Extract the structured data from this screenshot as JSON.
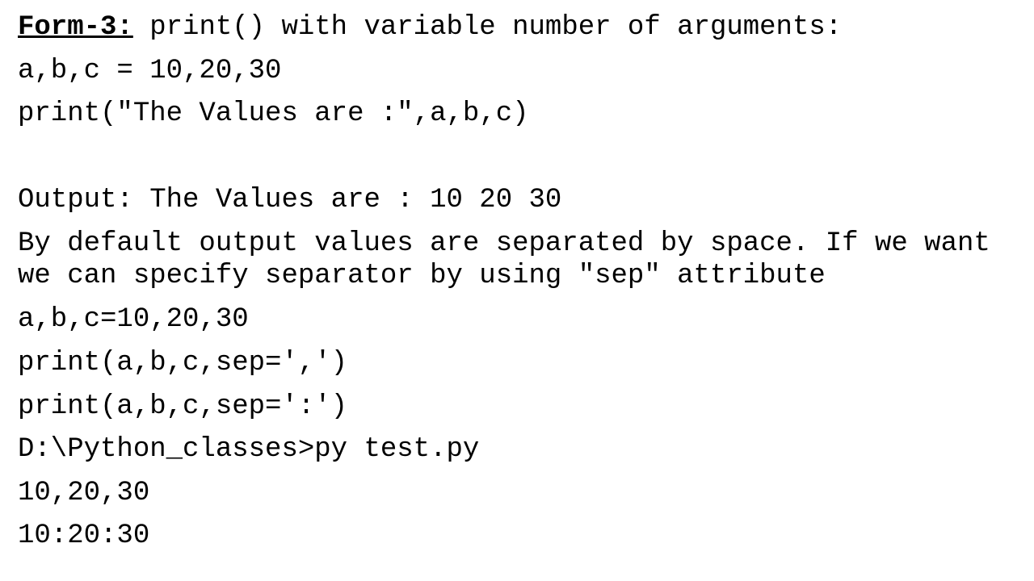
{
  "heading": {
    "label": "Form-3:",
    "text": " print() with variable number of arguments:"
  },
  "lines": [
    "a,b,c = 10,20,30",
    "print(\"The Values are :\",a,b,c)",
    "Output: The Values are : 10 20 30",
    "By default output values are separated by space. If we want",
    "we can specify separator by using \"sep\" attribute",
    "a,b,c=10,20,30",
    "print(a,b,c,sep=',')",
    "print(a,b,c,sep=':')",
    "D:\\Python_classes>py test.py",
    "10,20,30",
    "10:20:30"
  ]
}
